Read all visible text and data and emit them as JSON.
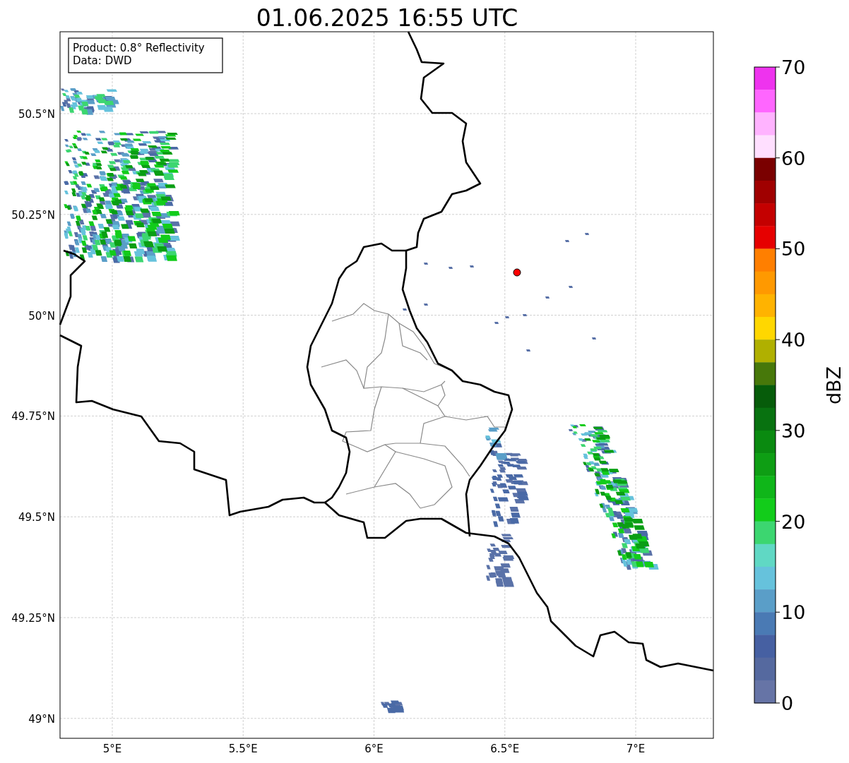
{
  "title": "01.06.2025 16:55 UTC",
  "info_box": [
    "Product: 0.8° Reflectivity",
    "Data: DWD"
  ],
  "map": {
    "x_ticks": [
      "5°E",
      "5.5°E",
      "6°E",
      "6.5°E",
      "7°E"
    ],
    "y_ticks": [
      "50.5°N",
      "50.25°N",
      "50°N",
      "49.75°N",
      "49.5°N",
      "49.25°N",
      "49°N"
    ]
  },
  "colorbar": {
    "label": "dBZ",
    "ticks": [
      "70",
      "60",
      "50",
      "40",
      "30",
      "20",
      "10",
      "0"
    ],
    "segments": [
      {
        "color": "#ee33ee"
      },
      {
        "color": "#ff66ff"
      },
      {
        "color": "#ffb3ff"
      },
      {
        "color": "#ffdfff"
      },
      {
        "color": "#7a0000"
      },
      {
        "color": "#a00000"
      },
      {
        "color": "#c40000"
      },
      {
        "color": "#e60000"
      },
      {
        "color": "#ff7f00"
      },
      {
        "color": "#ff9900"
      },
      {
        "color": "#ffb300"
      },
      {
        "color": "#ffd700"
      },
      {
        "color": "#b0b000"
      },
      {
        "color": "#47780a"
      },
      {
        "color": "#065c0a"
      },
      {
        "color": "#087210"
      },
      {
        "color": "#0a8a10"
      },
      {
        "color": "#0e9e14"
      },
      {
        "color": "#0fb619"
      },
      {
        "color": "#12cc1a"
      },
      {
        "color": "#3cd670"
      },
      {
        "color": "#60d8c4"
      },
      {
        "color": "#66c2dc"
      },
      {
        "color": "#5a9ec8"
      },
      {
        "color": "#4a7ab4"
      },
      {
        "color": "#4660a2"
      },
      {
        "color": "#55699f"
      },
      {
        "color": "#6674a6"
      }
    ]
  }
}
